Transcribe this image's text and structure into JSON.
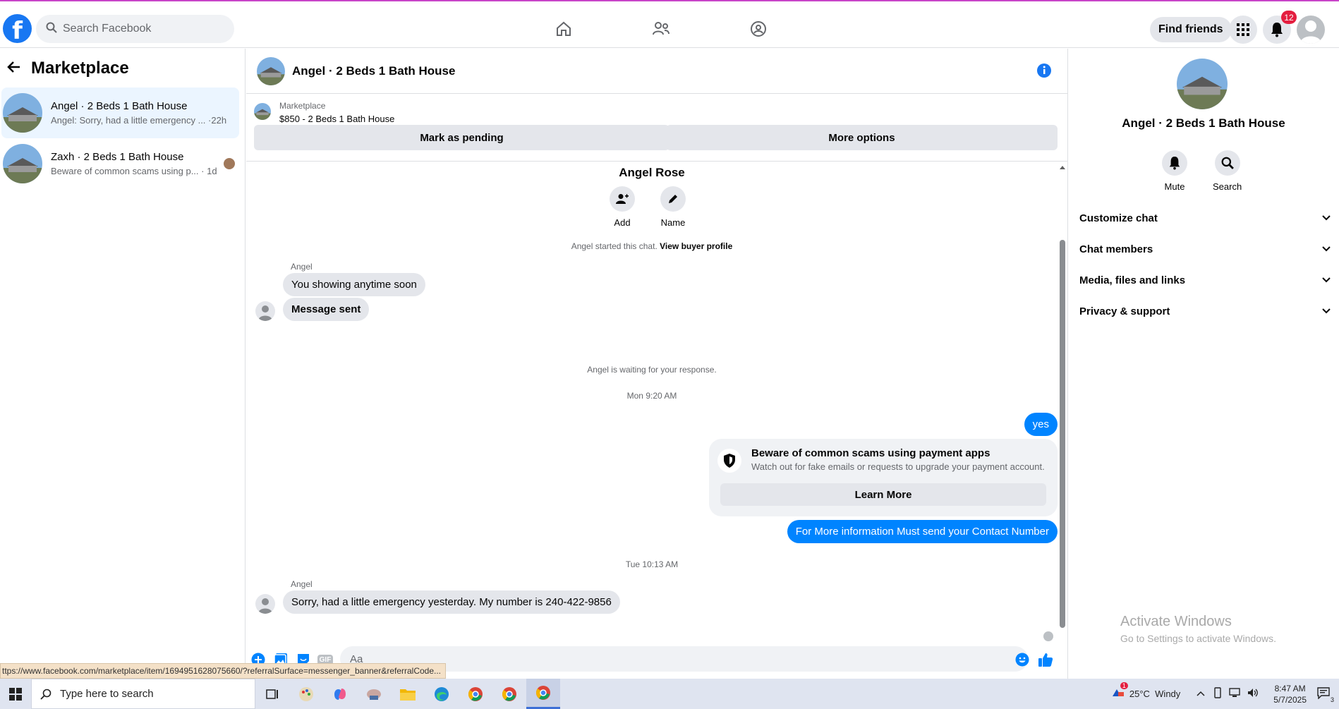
{
  "topbar": {
    "logo": "f",
    "search_placeholder": "Search Facebook",
    "find_friends": "Find friends",
    "notif_count": "12"
  },
  "left": {
    "title": "Marketplace",
    "conversations": [
      {
        "name": "Angel · 2 Beds 1 Bath House",
        "preview": "Angel: Sorry, had a little emergency ... ·22h"
      },
      {
        "name": "Zaxh · 2 Beds 1 Bath House",
        "preview": "Beware of common scams using p... · 1d"
      }
    ]
  },
  "chat": {
    "title": "Angel · 2 Beds 1 Bath House",
    "listing_label": "Marketplace",
    "listing_price": "$850 - 2 Beds 1 Bath House",
    "mark_pending": "Mark as pending",
    "more_options": "More options",
    "profile_name": "Angel Rose",
    "add_label": "Add",
    "name_label": "Name",
    "started_text": "Angel started this chat.",
    "view_buyer": "View buyer profile",
    "sender1": "Angel",
    "msg1": "You showing anytime soon",
    "msg2": "Message sent",
    "waiting": "Angel is waiting for your response.",
    "time1": "Mon 9:20 AM",
    "out1": "yes",
    "scam_title": "Beware of common scams using payment apps",
    "scam_sub": "Watch out for fake emails or requests to upgrade your payment account.",
    "learn_more": "Learn More",
    "out2": "For More information Must send your Contact Number",
    "time2": "Tue 10:13 AM",
    "sender2": "Angel",
    "msg3": "Sorry, had a little emergency yesterday. My number is 240-422-9856",
    "composer_placeholder": "Aa",
    "gif": "GIF"
  },
  "status_url": "ttps://www.facebook.com/marketplace/item/1694951628075660/?referralSurface=messenger_banner&referralCode...",
  "right": {
    "name": "Angel · 2 Beds 1 Bath House",
    "mute": "Mute",
    "search": "Search",
    "items": [
      "Customize chat",
      "Chat members",
      "Media, files and links",
      "Privacy & support"
    ]
  },
  "watermark": {
    "line1": "Activate Windows",
    "line2": "Go to Settings to activate Windows."
  },
  "taskbar": {
    "search": "Type here to search",
    "weather": "25°C  Windy",
    "time": "8:47 AM",
    "date": "5/7/2025",
    "notif_badge": "3",
    "weather_badge": "1"
  },
  "colors": {
    "brand": "#1877f2",
    "outgoing": "#0084ff",
    "active_row": "#ebf5ff"
  }
}
